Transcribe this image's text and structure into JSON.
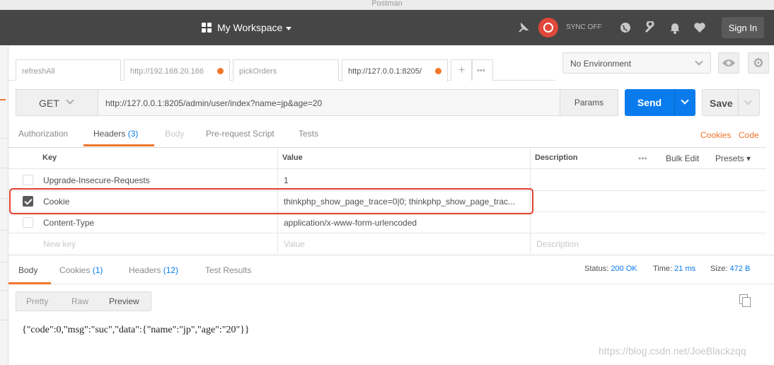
{
  "window_title": "Postman",
  "header": {
    "workspace": "My Workspace",
    "sync_text": "SYNC OFF",
    "sign_in": "Sign In",
    "icons": [
      "satellite-icon",
      "sync-icon",
      "globe-icon",
      "wrench-icon",
      "bell-icon",
      "heart-icon"
    ]
  },
  "tabs": [
    {
      "label": "refreshAll",
      "modified": false
    },
    {
      "label": "http://192.168.20.166",
      "modified": true
    },
    {
      "label": "pickOrders",
      "modified": false
    },
    {
      "label": "http://127.0.0.1:8205/",
      "modified": true,
      "active": true
    }
  ],
  "tab_actions": {
    "add": "+",
    "more": "•••"
  },
  "environment": {
    "selected": "No Environment"
  },
  "request": {
    "method": "GET",
    "url": "http://127.0.0.1:8205/admin/user/index?name=jp&age=20",
    "params_label": "Params",
    "send_label": "Send",
    "save_label": "Save"
  },
  "request_tabs": [
    {
      "label": "Authorization",
      "count": ""
    },
    {
      "label": "Headers",
      "count": "(3)"
    },
    {
      "label": "Body",
      "count": ""
    },
    {
      "label": "Pre-request Script",
      "count": ""
    },
    {
      "label": "Tests",
      "count": ""
    }
  ],
  "request_links": {
    "cookies": "Cookies",
    "code": "Code"
  },
  "headers_table": {
    "columns": [
      "Key",
      "Value",
      "Description"
    ],
    "more": "•••",
    "bulk_edit": "Bulk Edit",
    "presets": "Presets",
    "rows": [
      {
        "key": "Upgrade-Insecure-Requests",
        "value": "1",
        "checked": false
      },
      {
        "key": "Cookie",
        "value": "thinkphp_show_page_trace=0|0; thinkphp_show_page_trac...",
        "checked": true
      },
      {
        "key": "Content-Type",
        "value": "application/x-www-form-urlencoded",
        "checked": false
      }
    ],
    "placeholders": {
      "key": "New key",
      "value": "Value",
      "description": "Description"
    }
  },
  "response_tabs": [
    {
      "label": "Body",
      "count": ""
    },
    {
      "label": "Cookies",
      "count": "(1)"
    },
    {
      "label": "Headers",
      "count": "(12)"
    },
    {
      "label": "Test Results",
      "count": ""
    }
  ],
  "response_status": {
    "status_label": "Status:",
    "status_value": "200 OK",
    "time_label": "Time:",
    "time_value": "21 ms",
    "size_label": "Size:",
    "size_value": "472 B"
  },
  "view_modes": [
    "Pretty",
    "Raw",
    "Preview"
  ],
  "response_body": "{\"code\":0,\"msg\":\"suc\",\"data\":{\"name\":\"jp\",\"age\":\"20\"}}",
  "watermark": "https://blog.csdn.net/JoeBlackzqq",
  "colors": {
    "accent": "#f0752b",
    "send": "#097bed",
    "header_bg": "#464646",
    "highlight": "#e53f2f"
  }
}
